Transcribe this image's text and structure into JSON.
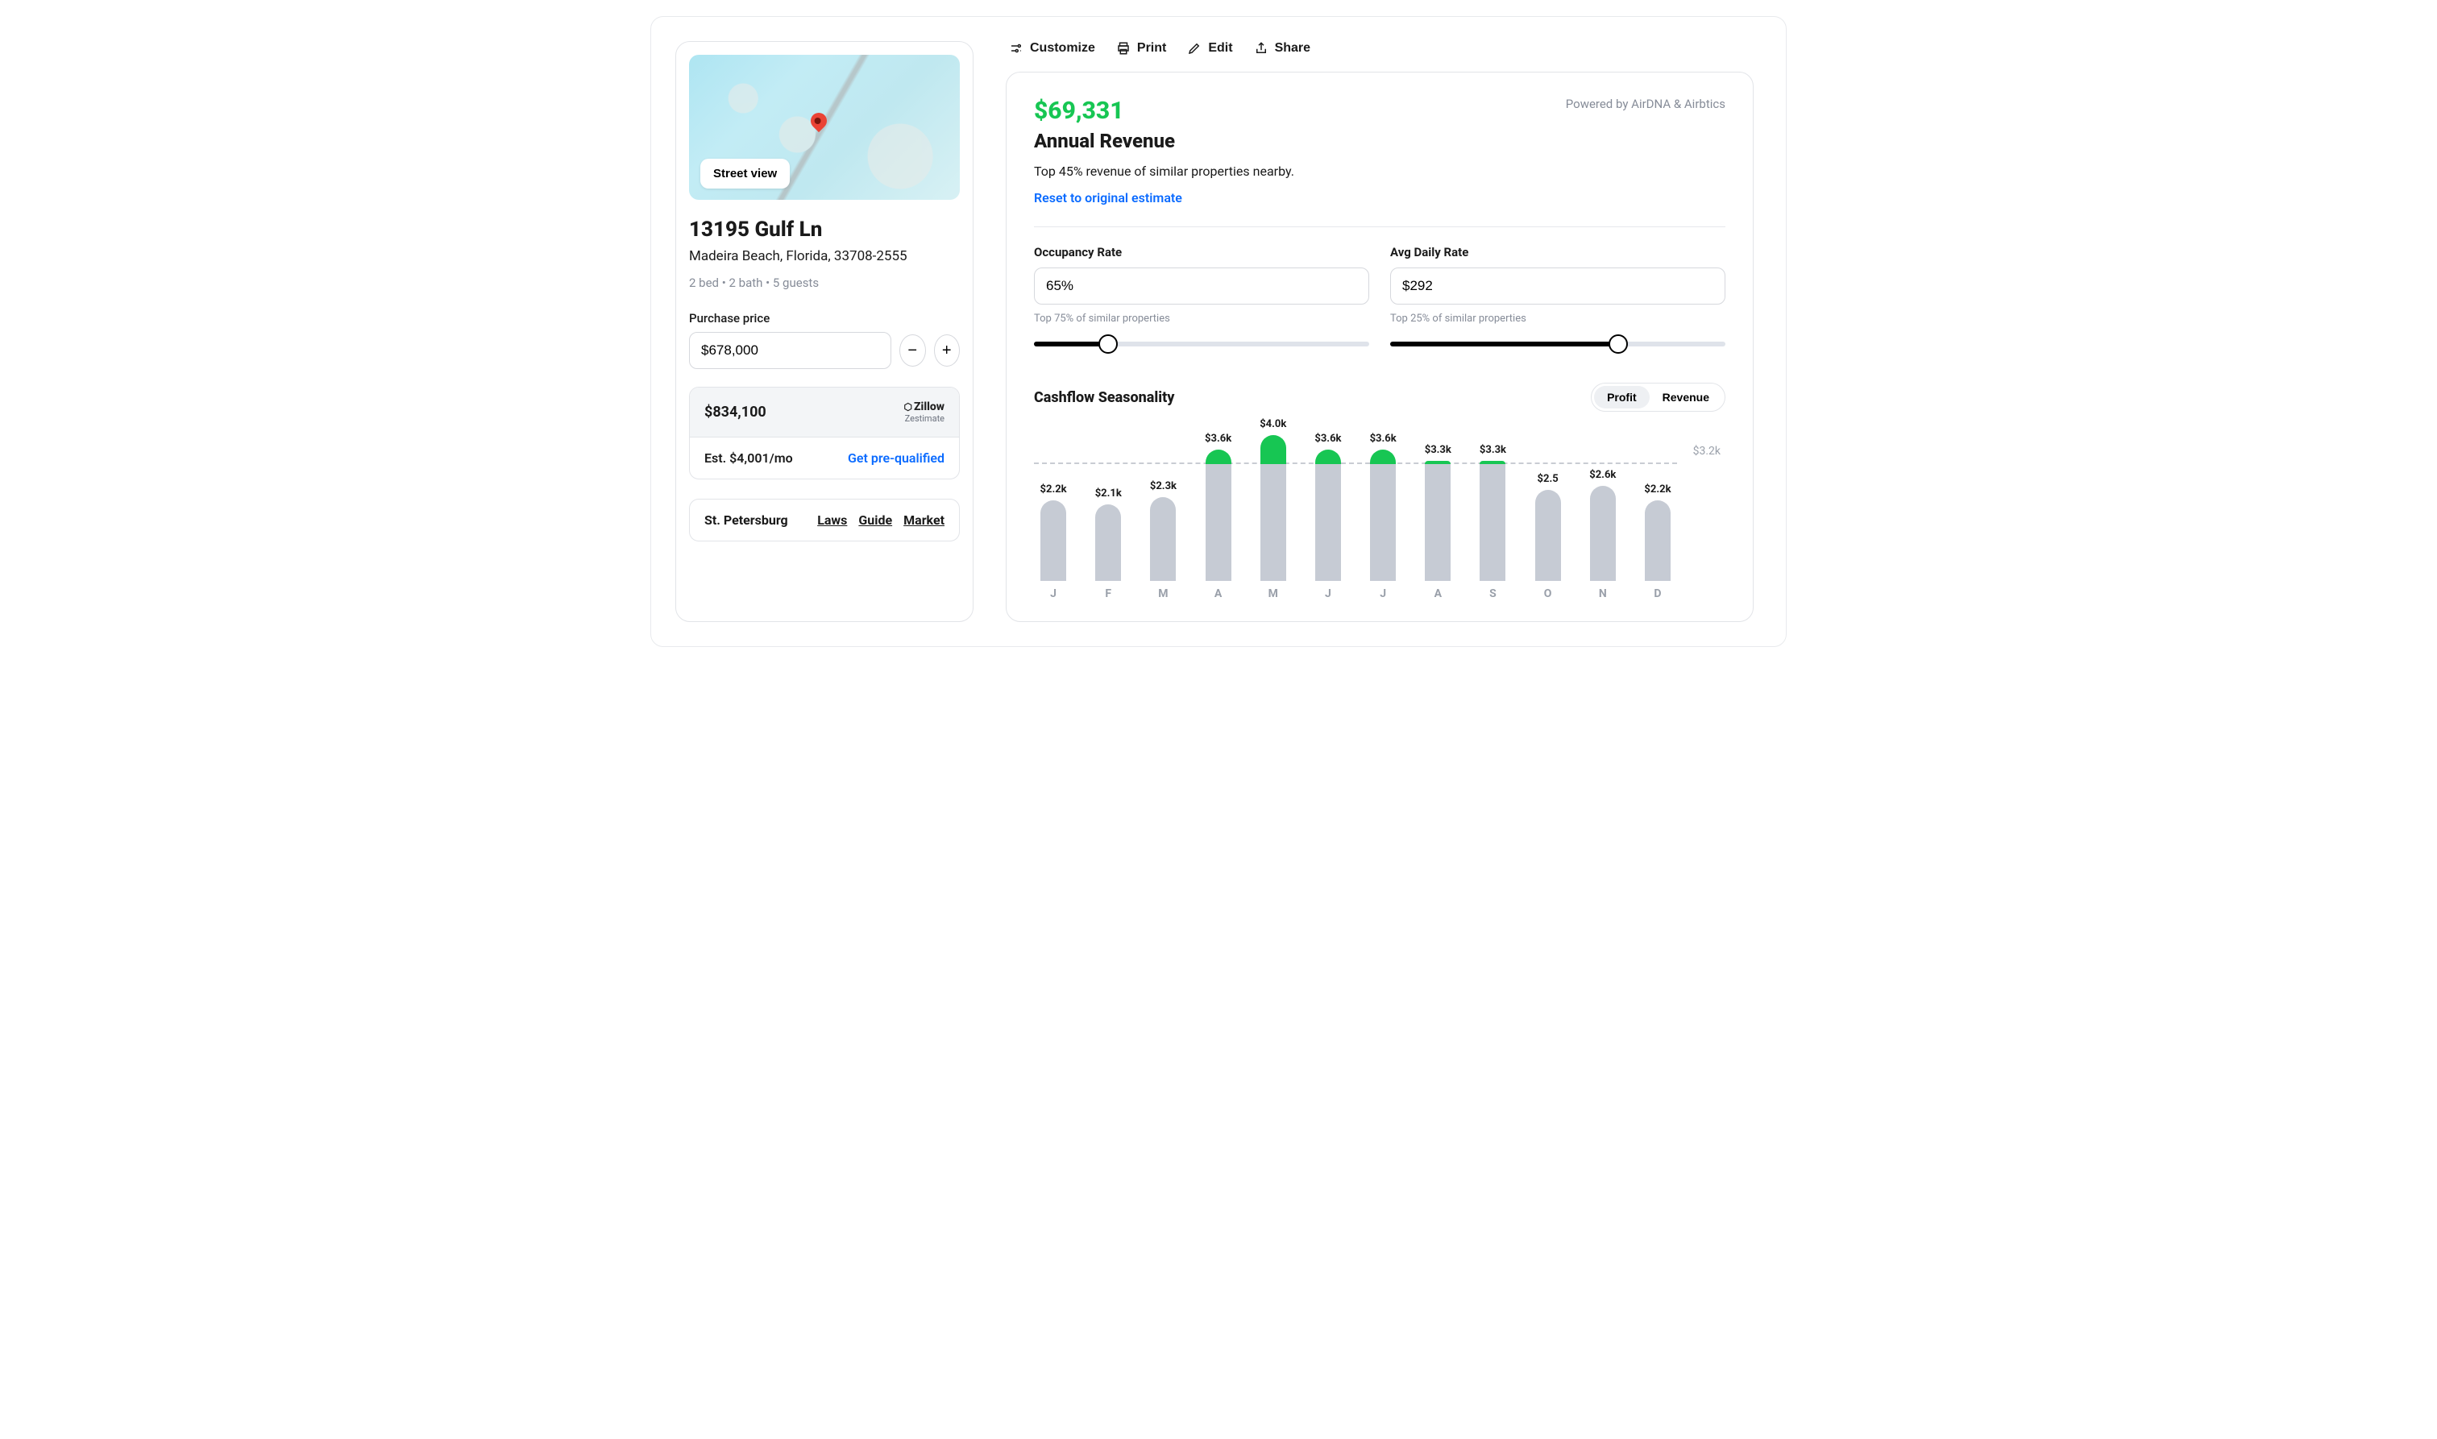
{
  "toolbar": {
    "customize": "Customize",
    "print": "Print",
    "edit": "Edit",
    "share": "Share"
  },
  "property": {
    "street_view": "Street view",
    "title": "13195 Gulf Ln",
    "subtitle": "Madeira Beach, Florida, 33708-2555",
    "meta": "2 bed • 2 bath • 5 guests",
    "price_label": "Purchase price",
    "price_value": "$678,000",
    "zestimate_value": "$834,100",
    "zillow_brand": "Zillow",
    "zillow_sub": "Zestimate",
    "est_monthly": "Est. $4,001/mo",
    "prequalified": "Get pre-qualified",
    "city": "St. Petersburg",
    "links": {
      "laws": "Laws",
      "guide": "Guide",
      "market": "Market"
    }
  },
  "analysis": {
    "annual_amount": "$69,331",
    "annual_label": "Annual Revenue",
    "note": "Top 45% revenue of similar properties nearby.",
    "reset": "Reset to original estimate",
    "powered": "Powered by AirDNA & Airbtics",
    "occupancy_label": "Occupancy Rate",
    "occupancy_value": "65%",
    "occupancy_note": "Top 75% of similar properties",
    "adr_label": "Avg Daily Rate",
    "adr_value": "$292",
    "adr_note": "Top 25% of similar properties",
    "sliders": {
      "occupancy_pct": 22,
      "adr_pct": 68
    },
    "chart_title": "Cashflow Seasonality",
    "toggle": {
      "profit": "Profit",
      "revenue": "Revenue",
      "active": "profit"
    },
    "baseline_label": "$3.2k"
  },
  "chart_data": {
    "type": "bar",
    "title": "Cashflow Seasonality",
    "xlabel": "",
    "ylabel": "",
    "ylim": [
      0,
      4.2
    ],
    "baseline": 3.2,
    "categories": [
      "J",
      "F",
      "M",
      "A",
      "M",
      "J",
      "J",
      "A",
      "S",
      "O",
      "N",
      "D"
    ],
    "values": [
      2.2,
      2.1,
      2.3,
      3.6,
      4.0,
      3.6,
      3.6,
      3.3,
      3.3,
      2.5,
      2.6,
      2.2
    ],
    "value_labels": [
      "$2.2k",
      "$2.1k",
      "$2.3k",
      "$3.6k",
      "$4.0k",
      "$3.6k",
      "$3.6k",
      "$3.3k",
      "$3.3k",
      "$2.5",
      "$2.6k",
      "$2.2k"
    ]
  }
}
